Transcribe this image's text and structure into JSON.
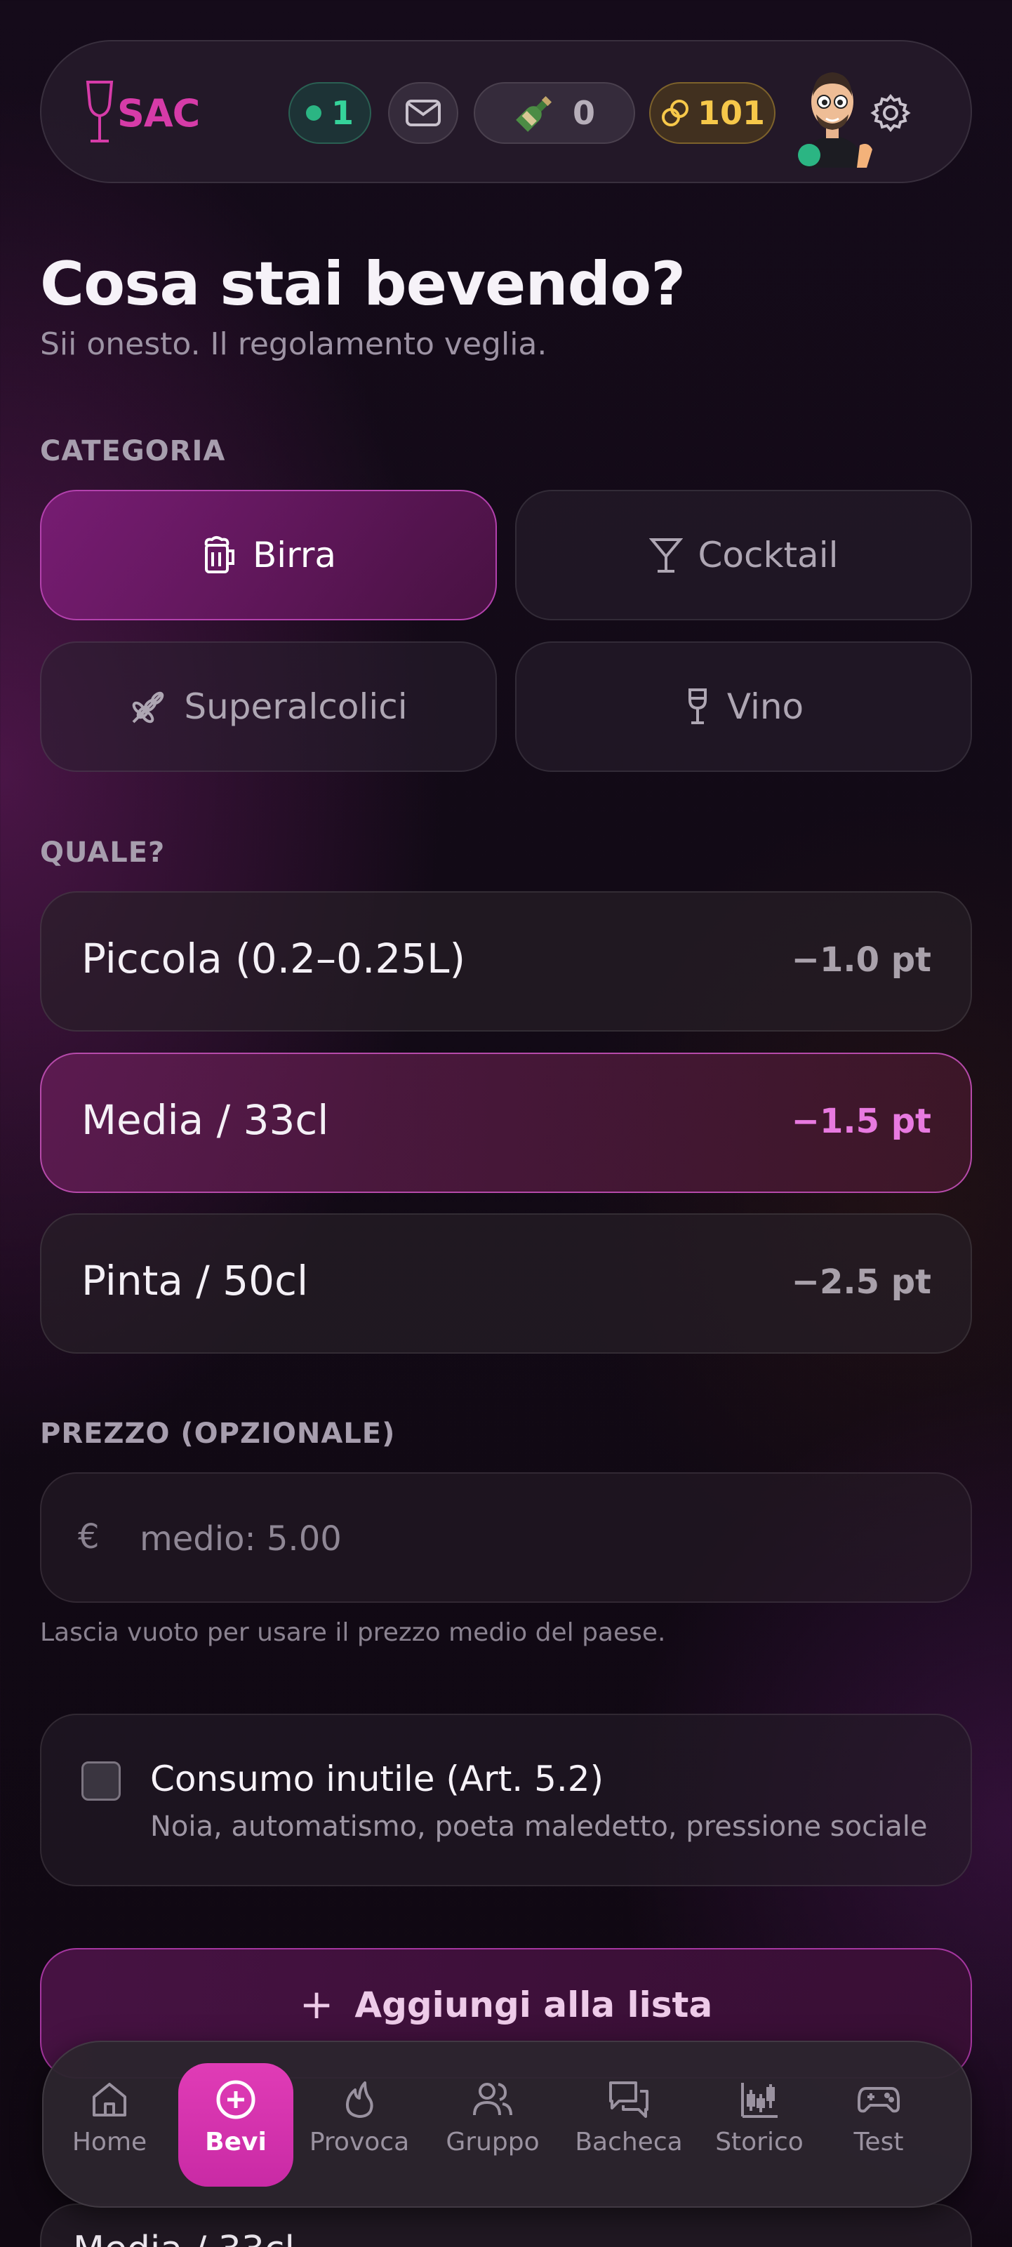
{
  "header": {
    "logo_text": "SAC",
    "online_count": "1",
    "bottle_count": "0",
    "coins": "101"
  },
  "page": {
    "title": "Cosa stai bevendo?",
    "subtitle": "Sii onesto. Il regolamento veglia."
  },
  "category": {
    "label": "CATEGORIA",
    "items": [
      {
        "label": "Birra",
        "icon": "beer-mug-icon",
        "selected": true
      },
      {
        "label": "Cocktail",
        "icon": "cocktail-glass-icon",
        "selected": false
      },
      {
        "label": "Superalcolici",
        "icon": "wheat-icon",
        "selected": false
      },
      {
        "label": "Vino",
        "icon": "wine-glass-icon",
        "selected": false
      }
    ]
  },
  "which": {
    "label": "QUALE?",
    "options": [
      {
        "name": "Piccola (0.2–0.25L)",
        "points": "−1.0 pt",
        "selected": false
      },
      {
        "name": "Media / 33cl",
        "points": "−1.5 pt",
        "selected": true
      },
      {
        "name": "Pinta / 50cl",
        "points": "−2.5 pt",
        "selected": false
      }
    ]
  },
  "price": {
    "label": "PREZZO (OPZIONALE)",
    "currency": "€",
    "placeholder": "medio: 5.00",
    "hint": "Lascia vuoto per usare il prezzo medio del paese."
  },
  "waste": {
    "title": "Consumo inutile (Art. 5.2)",
    "subtitle": "Noia, automatismo, poeta maledetto, pressione sociale",
    "checked": false
  },
  "add_button": {
    "plus": "+",
    "label": "Aggiungi alla lista"
  },
  "partial_card": {
    "text": "Media / 33cl"
  },
  "nav": {
    "items": [
      {
        "label": "Home",
        "icon": "home-icon",
        "active": false
      },
      {
        "label": "Bevi",
        "icon": "plus-circle-icon",
        "active": true
      },
      {
        "label": "Provoca",
        "icon": "flame-icon",
        "active": false
      },
      {
        "label": "Gruppo",
        "icon": "users-icon",
        "active": false
      },
      {
        "label": "Bacheca",
        "icon": "chat-bubbles-icon",
        "active": false
      },
      {
        "label": "Storico",
        "icon": "chart-icon",
        "active": false
      },
      {
        "label": "Test",
        "icon": "gamepad-icon",
        "active": false
      }
    ]
  },
  "colors": {
    "accent": "#d63ba8",
    "online": "#2bb583",
    "coins": "#f6c84a"
  }
}
